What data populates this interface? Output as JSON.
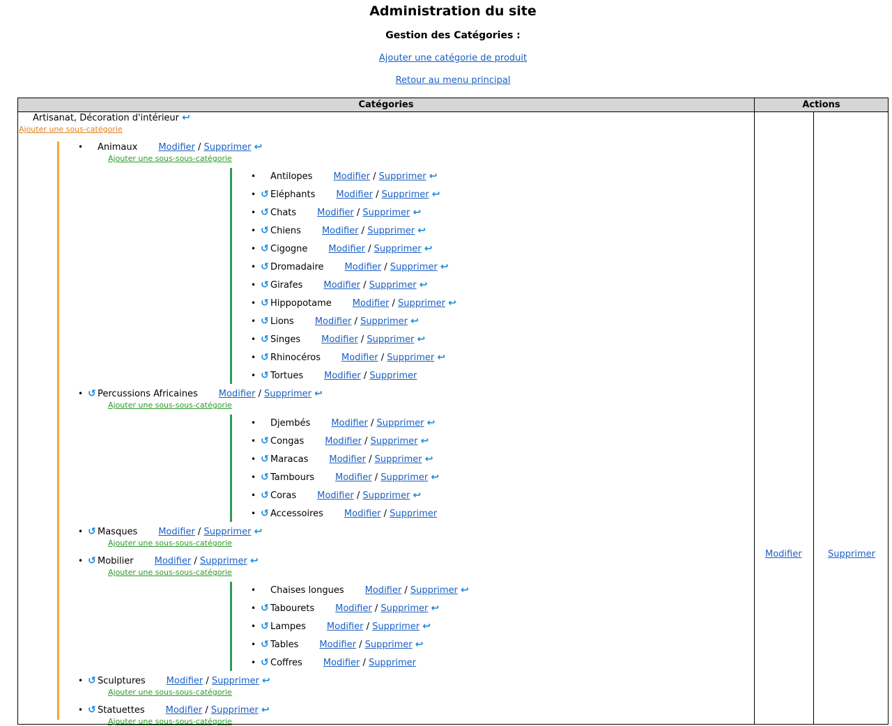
{
  "page": {
    "title": "Administration du site",
    "subtitle": "Gestion des Catégories :",
    "add_category_link": "Ajouter une catégorie de produit",
    "back_link": "Retour au menu principal"
  },
  "table": {
    "header_categories": "Catégories",
    "header_actions": "Actions",
    "action_modify": "Modifier",
    "action_delete": "Supprimer"
  },
  "labels": {
    "modify": "Modifier",
    "delete": "Supprimer",
    "separator": "/",
    "add_subcategory": "Ajouter une sous-catégorie",
    "add_subsubcategory": "Ajouter une sous-sous-catégorie"
  },
  "icons": {
    "move_up": "↺",
    "move_down": "↩"
  },
  "colors": {
    "link": "#1a5fc4",
    "orange_bar": "#f0a83c",
    "green_bar": "#2e9a55",
    "add_sub_orange": "#e0801a",
    "add_subsub_green": "#2a9a2a",
    "header_bg": "#d6d6d6",
    "icon": "#1a8ad6"
  },
  "root_category": {
    "name": "Artisanat, Décoration d'intérieur"
  },
  "subcategories": [
    {
      "name": "Animaux",
      "has_up": false,
      "has_down": true,
      "children": [
        {
          "name": "Antilopes",
          "has_up": false,
          "has_down": true
        },
        {
          "name": "Eléphants",
          "has_up": true,
          "has_down": true
        },
        {
          "name": "Chats",
          "has_up": true,
          "has_down": true
        },
        {
          "name": "Chiens",
          "has_up": true,
          "has_down": true
        },
        {
          "name": "Cigogne",
          "has_up": true,
          "has_down": true
        },
        {
          "name": "Dromadaire",
          "has_up": true,
          "has_down": true
        },
        {
          "name": "Girafes",
          "has_up": true,
          "has_down": true
        },
        {
          "name": "Hippopotame",
          "has_up": true,
          "has_down": true
        },
        {
          "name": "Lions",
          "has_up": true,
          "has_down": true
        },
        {
          "name": "Singes",
          "has_up": true,
          "has_down": true
        },
        {
          "name": "Rhinocéros",
          "has_up": true,
          "has_down": true
        },
        {
          "name": "Tortues",
          "has_up": true,
          "has_down": false
        }
      ]
    },
    {
      "name": "Percussions Africaines",
      "has_up": true,
      "has_down": true,
      "children": [
        {
          "name": "Djembés",
          "has_up": false,
          "has_down": true
        },
        {
          "name": "Congas",
          "has_up": true,
          "has_down": true
        },
        {
          "name": "Maracas",
          "has_up": true,
          "has_down": true
        },
        {
          "name": "Tambours",
          "has_up": true,
          "has_down": true
        },
        {
          "name": "Coras",
          "has_up": true,
          "has_down": true
        },
        {
          "name": "Accessoires",
          "has_up": true,
          "has_down": false
        }
      ]
    },
    {
      "name": "Masques",
      "has_up": true,
      "has_down": true,
      "children": []
    },
    {
      "name": "Mobilier",
      "has_up": true,
      "has_down": true,
      "children": [
        {
          "name": "Chaises longues",
          "has_up": false,
          "has_down": true
        },
        {
          "name": "Tabourets",
          "has_up": true,
          "has_down": true
        },
        {
          "name": "Lampes",
          "has_up": true,
          "has_down": true
        },
        {
          "name": "Tables",
          "has_up": true,
          "has_down": true
        },
        {
          "name": "Coffres",
          "has_up": true,
          "has_down": false
        }
      ]
    },
    {
      "name": "Sculptures",
      "has_up": true,
      "has_down": true,
      "children": []
    },
    {
      "name": "Statuettes",
      "has_up": true,
      "has_down": true,
      "children": []
    }
  ]
}
